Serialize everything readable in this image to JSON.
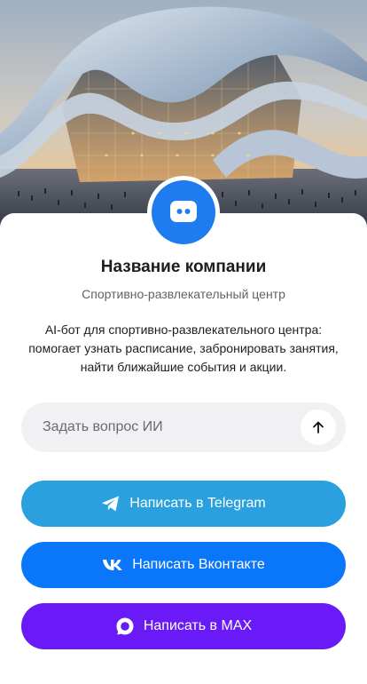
{
  "company": {
    "name": "Название компании",
    "subtitle": "Спортивно-развлекательный центр",
    "description": "AI-бот для спортивно-развлекательного центра: помогает узнать расписание, забронировать занятия, найти ближайшие события и акции."
  },
  "ask": {
    "placeholder": "Задать вопрос ИИ",
    "value": ""
  },
  "buttons": {
    "telegram": "Написать в Telegram",
    "vk": "Написать Вконтакте",
    "max": "Написать в MAX"
  },
  "colors": {
    "avatar": "#1f7bf0",
    "telegram": "#2aa1de",
    "vk": "#0a77fb",
    "max": "#6a1af7"
  },
  "icons": {
    "avatar": "chat-bot-icon",
    "send": "arrow-up-icon",
    "telegram": "telegram-icon",
    "vk": "vk-icon",
    "max": "max-icon"
  }
}
